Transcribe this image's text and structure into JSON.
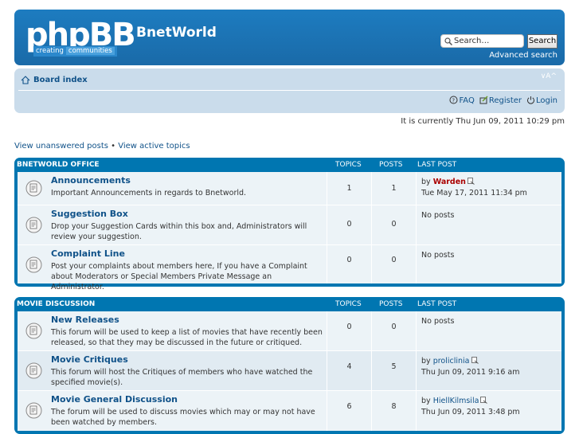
{
  "header": {
    "logo_text": "phpBB",
    "logo_tag_1": "creating",
    "logo_tag_2": "communities",
    "site_title": "BnetWorld",
    "search_placeholder": "Search…",
    "search_button": "Search",
    "advanced_search": "Advanced search"
  },
  "navbar": {
    "board_index": "Board index",
    "font_toggle": "∨A^",
    "faq": "FAQ",
    "register": "Register",
    "login": "Login"
  },
  "datetime": "It is currently Thu Jun 09, 2011 10:29 pm",
  "quick_links": {
    "unanswered": "View unanswered posts",
    "separator": " • ",
    "active": "View active topics"
  },
  "columns": {
    "topics": "Topics",
    "posts": "Posts",
    "last_post": "Last post"
  },
  "categories": [
    {
      "title": "BnetWorld Office",
      "forums": [
        {
          "name": "Announcements",
          "desc": "Important Announcements in regards to Bnetworld.",
          "topics": "1",
          "posts": "1",
          "last_by": "by ",
          "last_author": "Warden",
          "last_time": "Tue May 17, 2011 11:34 pm"
        },
        {
          "name": "Suggestion Box",
          "desc": "Drop your Suggestion Cards within this box and, Administrators will review your suggestion.",
          "topics": "0",
          "posts": "0",
          "no_posts": "No posts"
        },
        {
          "name": "Complaint Line",
          "desc": "Post your complaints about members here, If you have a Complaint about Moderators or Special Members Private Message an Administrator.",
          "topics": "0",
          "posts": "0",
          "no_posts": "No posts"
        }
      ]
    },
    {
      "title": "Movie Discussion",
      "forums": [
        {
          "name": "New Releases",
          "desc": "This forum will be used to keep a list of movies that have recently been released, so that they may be discussed in the future or critiqued.",
          "topics": "0",
          "posts": "0",
          "no_posts": "No posts"
        },
        {
          "name": "Movie Critiques",
          "desc": "This forum will host the Critiques of members who have watched the specified movie(s).",
          "topics": "4",
          "posts": "5",
          "last_by": "by ",
          "last_author": "proliclinia",
          "last_time": "Thu Jun 09, 2011 9:16 am"
        },
        {
          "name": "Movie General Discussion",
          "desc": "The forum will be used to discuss movies which may or may not have been watched by members.",
          "topics": "6",
          "posts": "8",
          "last_by": "by ",
          "last_author": "HiellKilmsila",
          "last_time": "Thu Jun 09, 2011 3:48 pm"
        }
      ]
    }
  ],
  "colors": {
    "header_blue": "#1a6aa8",
    "nav_bg": "#cadceb",
    "forum_blue": "#0076b1",
    "row_bg": "#ecf3f7",
    "link": "#105289",
    "admin_red": "#aa0000"
  }
}
